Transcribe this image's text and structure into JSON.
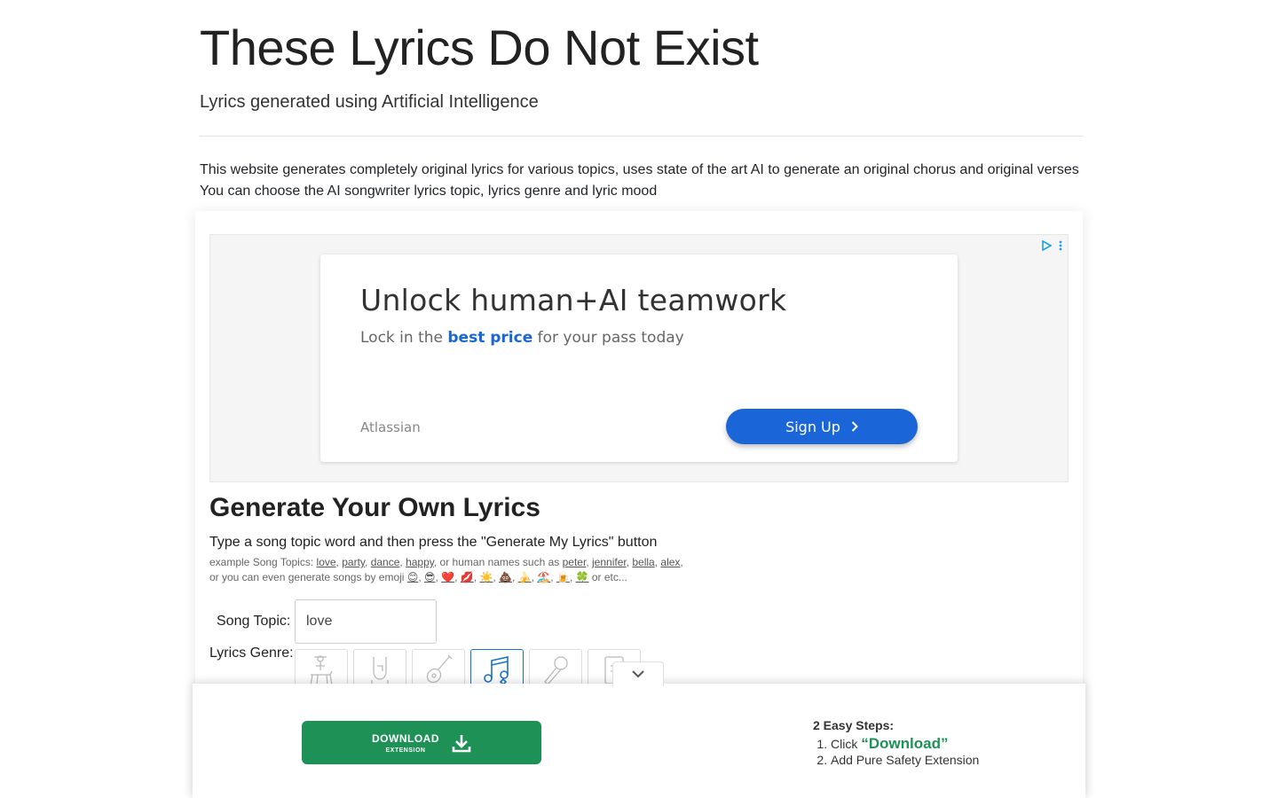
{
  "header": {
    "title": "These Lyrics Do Not Exist",
    "subtitle": "Lyrics generated using Artificial Intelligence"
  },
  "intro": {
    "line1": "This website generates completely original lyrics for various topics, uses state of the art AI to generate an original chorus and original verses",
    "line2": "You can choose the AI songwriter lyrics topic, lyrics genre and lyric mood"
  },
  "ad": {
    "headline": "Unlock human+AI teamwork",
    "desc_before": "Lock in the",
    "desc_highlight": "best price",
    "desc_after": "for your pass today",
    "brand": "Atlassian",
    "cta": "Sign Up"
  },
  "generator": {
    "title": "Generate Your Own Lyrics",
    "instruction": "Type a song topic word and then press the \"Generate My Lyrics\" button",
    "examples_prefix": "example Song Topics:",
    "topics": [
      "love",
      "party",
      "dance",
      "happy"
    ],
    "names_prefix": ", or human names such as",
    "names": [
      "peter",
      "jennifer",
      "bella",
      "alex"
    ],
    "emoji_prefix": "or you can even generate songs by emoji",
    "emojis": [
      "😊",
      "😎",
      "❤️",
      "💋",
      "☀️",
      "💩",
      "🍌",
      "🏖️",
      "🍺",
      "🍀"
    ],
    "emoji_suffix": "or etc...",
    "topic_label": "Song Topic:",
    "topic_value": "love",
    "genre_label": "Lyrics Genre:",
    "genres": [
      "country",
      "rock",
      "guitar",
      "pop",
      "rap",
      "other"
    ],
    "active_genre": "pop"
  },
  "banner": {
    "download_label": "DOWNLOAD",
    "download_sub": "EXTENSION",
    "steps_title": "2 Easy Steps:",
    "step1_prefix": "Click",
    "step1_highlight": "“Download”",
    "step2": "Add Pure Safety Extension"
  },
  "colors": {
    "accent_blue": "#1a66d9",
    "download_green": "#1e9157",
    "genre_active": "#1a73c8"
  }
}
